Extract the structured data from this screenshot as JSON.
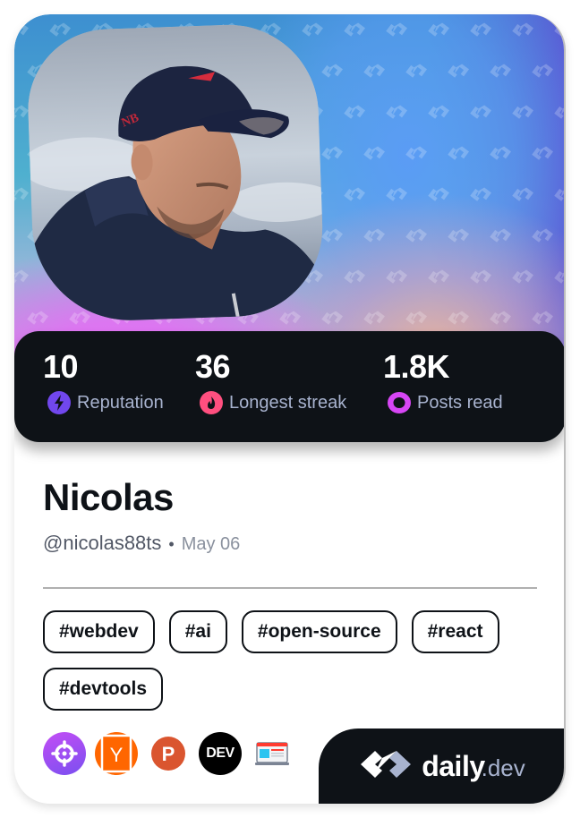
{
  "profile": {
    "name": "Nicolas",
    "handle": "@nicolas88ts",
    "separator": "•",
    "joined": "May 06",
    "avatar": "profile-photo"
  },
  "stats": [
    {
      "value": "10",
      "label": "Reputation",
      "icon": "lightning-icon",
      "color": "#7147ed"
    },
    {
      "value": "36",
      "label": "Longest streak",
      "icon": "flame-icon",
      "color": "#ff4f7f"
    },
    {
      "value": "1.8K",
      "label": "Posts read",
      "icon": "ring-icon",
      "color": "#d746f5"
    }
  ],
  "tags": [
    "#webdev",
    "#ai",
    "#open-source",
    "#react",
    "#devtools"
  ],
  "sources": [
    {
      "name": "crosshair-source",
      "icon": "crosshair-icon",
      "color": "#a145f5"
    },
    {
      "name": "hacker-news",
      "icon": "y-combinator-icon",
      "glyph": "Y",
      "color": "#ff6600"
    },
    {
      "name": "product-hunt",
      "icon": "product-hunt-icon",
      "glyph": "P",
      "color": "#da552f"
    },
    {
      "name": "dev-to",
      "icon": "dev-icon",
      "glyph": "DEV",
      "color": "#000000"
    },
    {
      "name": "browser-source",
      "icon": "browser-window-icon",
      "color": "#ff3b30"
    }
  ],
  "brand": {
    "name": "daily",
    "tld": ".dev"
  },
  "colors": {
    "dark": "#0e1217",
    "label": "#a8b3cf"
  }
}
